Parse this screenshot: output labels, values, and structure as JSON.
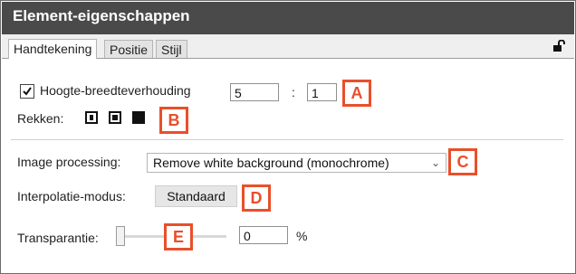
{
  "window": {
    "title": "Element-eigenschappen"
  },
  "tabs": [
    {
      "label": "Handtekening",
      "active": true
    },
    {
      "label": "Positie",
      "active": false
    },
    {
      "label": "Stijl",
      "active": false
    }
  ],
  "aspect_ratio": {
    "label": "Hoogte-breedteverhouding",
    "checked": true,
    "width_value": "5",
    "separator": ":",
    "height_value": "1"
  },
  "stretch": {
    "label": "Rekken:",
    "icons": [
      "stretch-option-1-icon",
      "stretch-option-2-icon",
      "stretch-option-3-icon"
    ]
  },
  "image_processing": {
    "label": "Image processing:",
    "value": "Remove white background (monochrome)"
  },
  "interpolation": {
    "label": "Interpolatie-modus:",
    "value": "Standaard"
  },
  "transparency": {
    "label": "Transparantie:",
    "value": "0",
    "unit": "%",
    "slider_level": 0
  },
  "callouts": [
    "A",
    "B",
    "C",
    "D",
    "E"
  ],
  "colors": {
    "titlebar": "#4a4a4a",
    "callout": "#e94f2a"
  }
}
